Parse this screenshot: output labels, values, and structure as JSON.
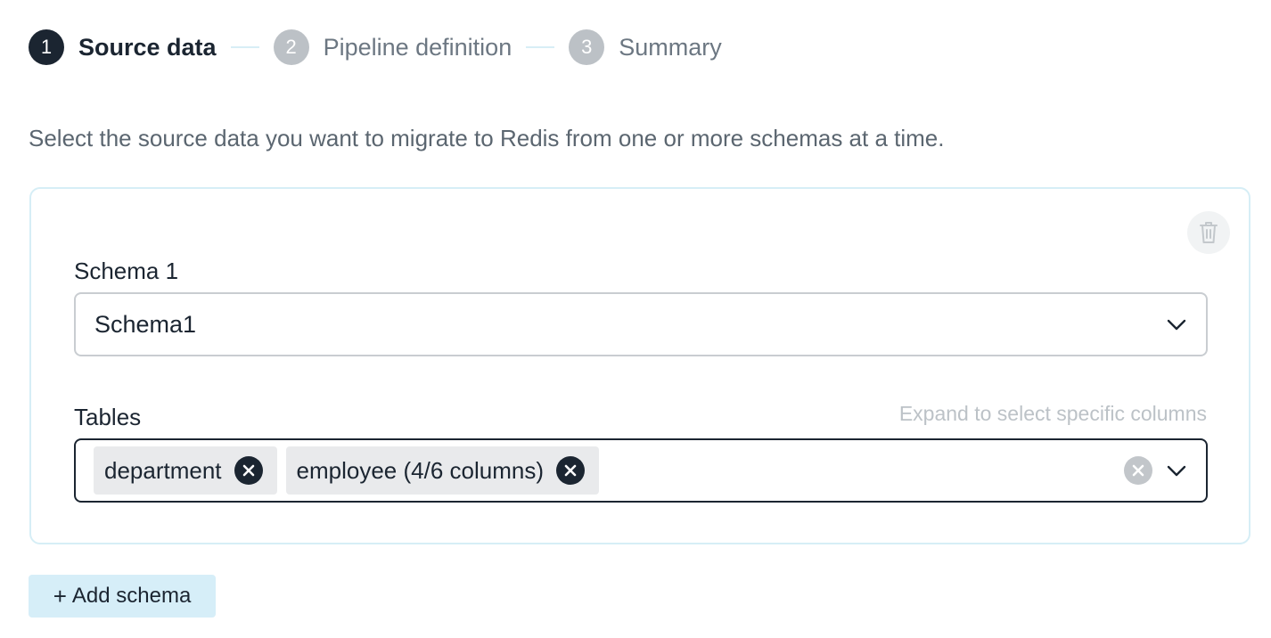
{
  "stepper": {
    "steps": [
      {
        "number": "1",
        "label": "Source data",
        "state": "active"
      },
      {
        "number": "2",
        "label": "Pipeline definition",
        "state": "inactive"
      },
      {
        "number": "3",
        "label": "Summary",
        "state": "inactive"
      }
    ]
  },
  "intro_text": "Select the source data you want to migrate to Redis from one or more schemas at a time.",
  "schema_card": {
    "delete_icon": "trash-icon",
    "schema_label": "Schema 1",
    "schema_value": "Schema1",
    "tables_label": "Tables",
    "tables_hint": "Expand to select specific columns",
    "selected_tables": [
      {
        "label": "department"
      },
      {
        "label": "employee (4/6 columns)"
      }
    ]
  },
  "add_schema": {
    "icon": "+",
    "label": "Add schema"
  },
  "colors": {
    "primary_dark": "#1b2531",
    "accent_light": "#d6eef8",
    "inactive_step": "#bcc1c6"
  }
}
